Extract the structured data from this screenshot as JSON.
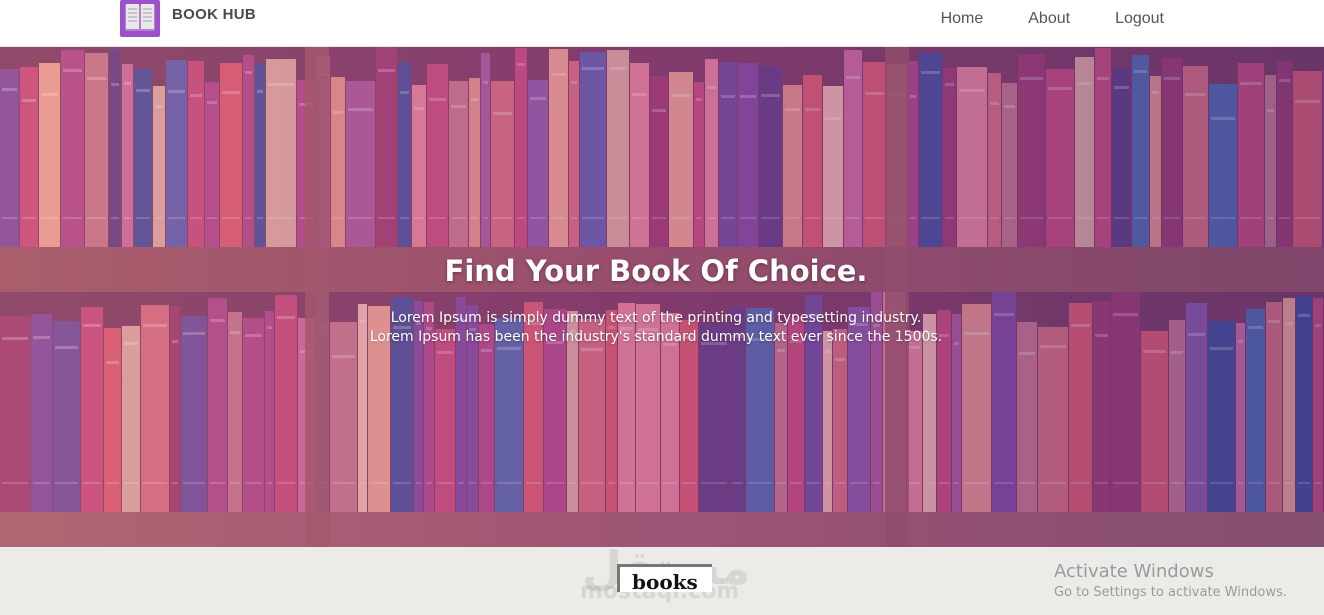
{
  "navbar": {
    "brand": "BOOK HUB",
    "links": [
      "Home",
      "About",
      "Logout"
    ]
  },
  "hero": {
    "title": "Find Your Book Of Choice.",
    "line1": "Lorem Ipsum is simply dummy text of the printing and typesetting industry.",
    "line2": "Lorem Ipsum has been the industry's standard dummy text ever since the 1500s."
  },
  "section": {
    "heading": "books"
  },
  "watermark": {
    "arabic": "مستقل",
    "latin": "mostaql.com"
  },
  "os_overlay": {
    "title": "Activate Windows",
    "subtitle": "Go to Settings to activate Windows."
  },
  "colors": {
    "accent": "#9b52c9",
    "hero_tint": "#7a3e6a"
  }
}
